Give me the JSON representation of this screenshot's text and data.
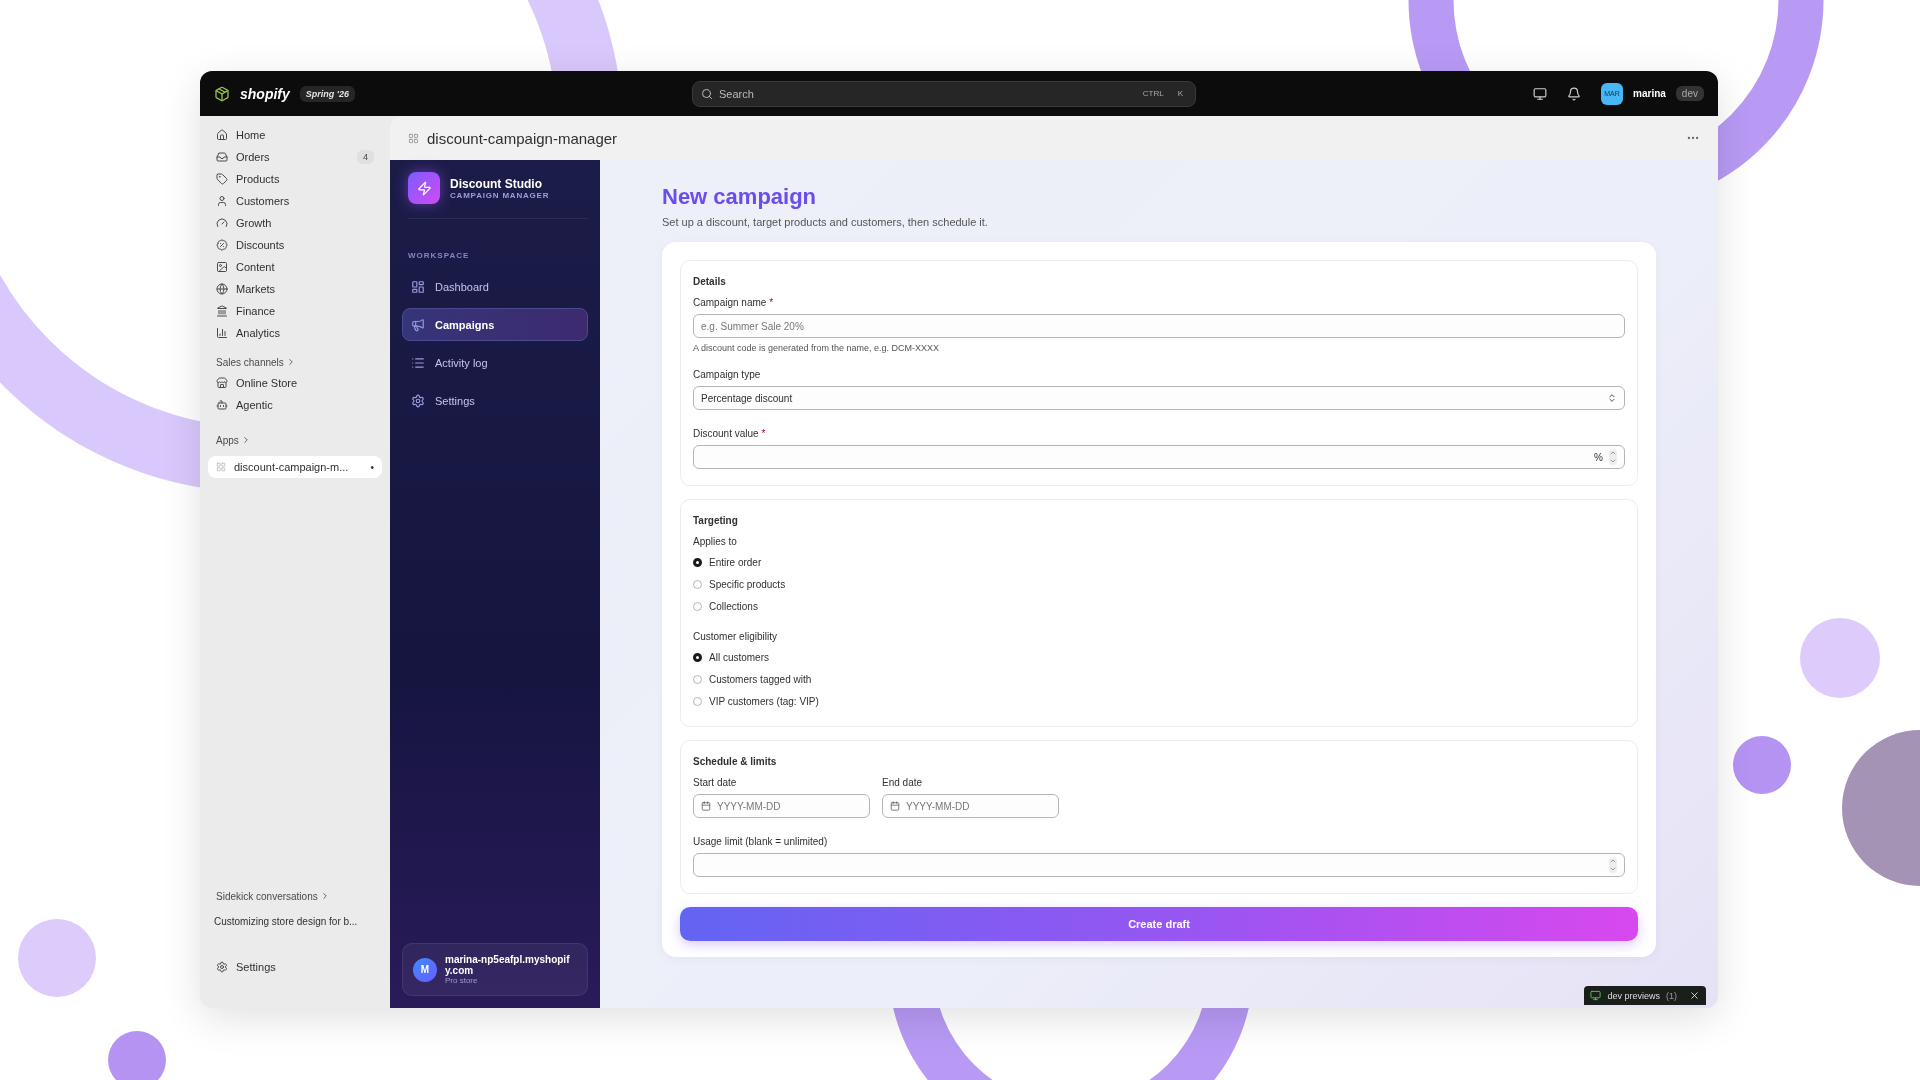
{
  "topbar": {
    "brand": "shopify",
    "edition": "Spring '26",
    "search": {
      "placeholder": "Search",
      "keys": [
        "CTRL",
        "K"
      ]
    },
    "user": {
      "initials": "MAR",
      "name": "marina",
      "badge": "dev"
    }
  },
  "nav": {
    "items": [
      {
        "label": "Home"
      },
      {
        "label": "Orders",
        "count": "4"
      },
      {
        "label": "Products"
      },
      {
        "label": "Customers"
      },
      {
        "label": "Growth"
      },
      {
        "label": "Discounts"
      },
      {
        "label": "Content"
      },
      {
        "label": "Markets"
      },
      {
        "label": "Finance"
      },
      {
        "label": "Analytics"
      }
    ],
    "sales_channels": {
      "title": "Sales channels",
      "items": [
        {
          "label": "Online Store"
        },
        {
          "label": "Agentic"
        }
      ]
    },
    "apps": {
      "title": "Apps",
      "items": [
        {
          "label": "discount-campaign-m...",
          "selected": true,
          "marker": "•"
        }
      ]
    },
    "sidekick": {
      "title": "Sidekick conversations",
      "items": [
        {
          "label": "Customizing store design for b..."
        }
      ]
    },
    "settings": "Settings"
  },
  "page_header": {
    "title": "discount-campaign-manager"
  },
  "app_sidebar": {
    "name": "Discount Studio",
    "subtitle": "CAMPAIGN MANAGER",
    "section": "WORKSPACE",
    "items": [
      {
        "label": "Dashboard",
        "selected": false
      },
      {
        "label": "Campaigns",
        "selected": true
      },
      {
        "label": "Activity log",
        "selected": false
      },
      {
        "label": "Settings",
        "selected": false
      }
    ],
    "store": {
      "initial": "M",
      "name": "marina-np5eafpl.myshopify.com",
      "plan": "Pro store"
    }
  },
  "form": {
    "title": "New campaign",
    "subtitle": "Set up a discount, target products and customers, then schedule it.",
    "details": {
      "title": "Details",
      "required_mark": "*",
      "name_label": "Campaign name",
      "name_placeholder": "e.g. Summer Sale 20%",
      "name_help": "A discount code is generated from the name, e.g. DCM-XXXX",
      "type_label": "Campaign type",
      "type_value": "Percentage discount",
      "value_label": "Discount value",
      "value_suffix": "%"
    },
    "targeting": {
      "title": "Targeting",
      "groups": [
        {
          "label": "Applies to",
          "options": [
            {
              "label": "Entire order",
              "selected": true
            },
            {
              "label": "Specific products",
              "selected": false
            },
            {
              "label": "Collections",
              "selected": false
            }
          ]
        },
        {
          "label": "Customer eligibility",
          "options": [
            {
              "label": "All customers",
              "selected": true
            },
            {
              "label": "Customers tagged with",
              "selected": false
            },
            {
              "label": "VIP customers (tag: VIP)",
              "selected": false
            }
          ]
        }
      ]
    },
    "schedule": {
      "title": "Schedule & limits",
      "start_label": "Start date",
      "start_placeholder": "YYYY-MM-DD",
      "end_label": "End date",
      "end_placeholder": "YYYY-MM-DD",
      "limit_label": "Usage limit (blank = unlimited)"
    },
    "submit": "Create draft"
  },
  "dev_previews": {
    "label": "dev previews",
    "count": "(1)"
  }
}
